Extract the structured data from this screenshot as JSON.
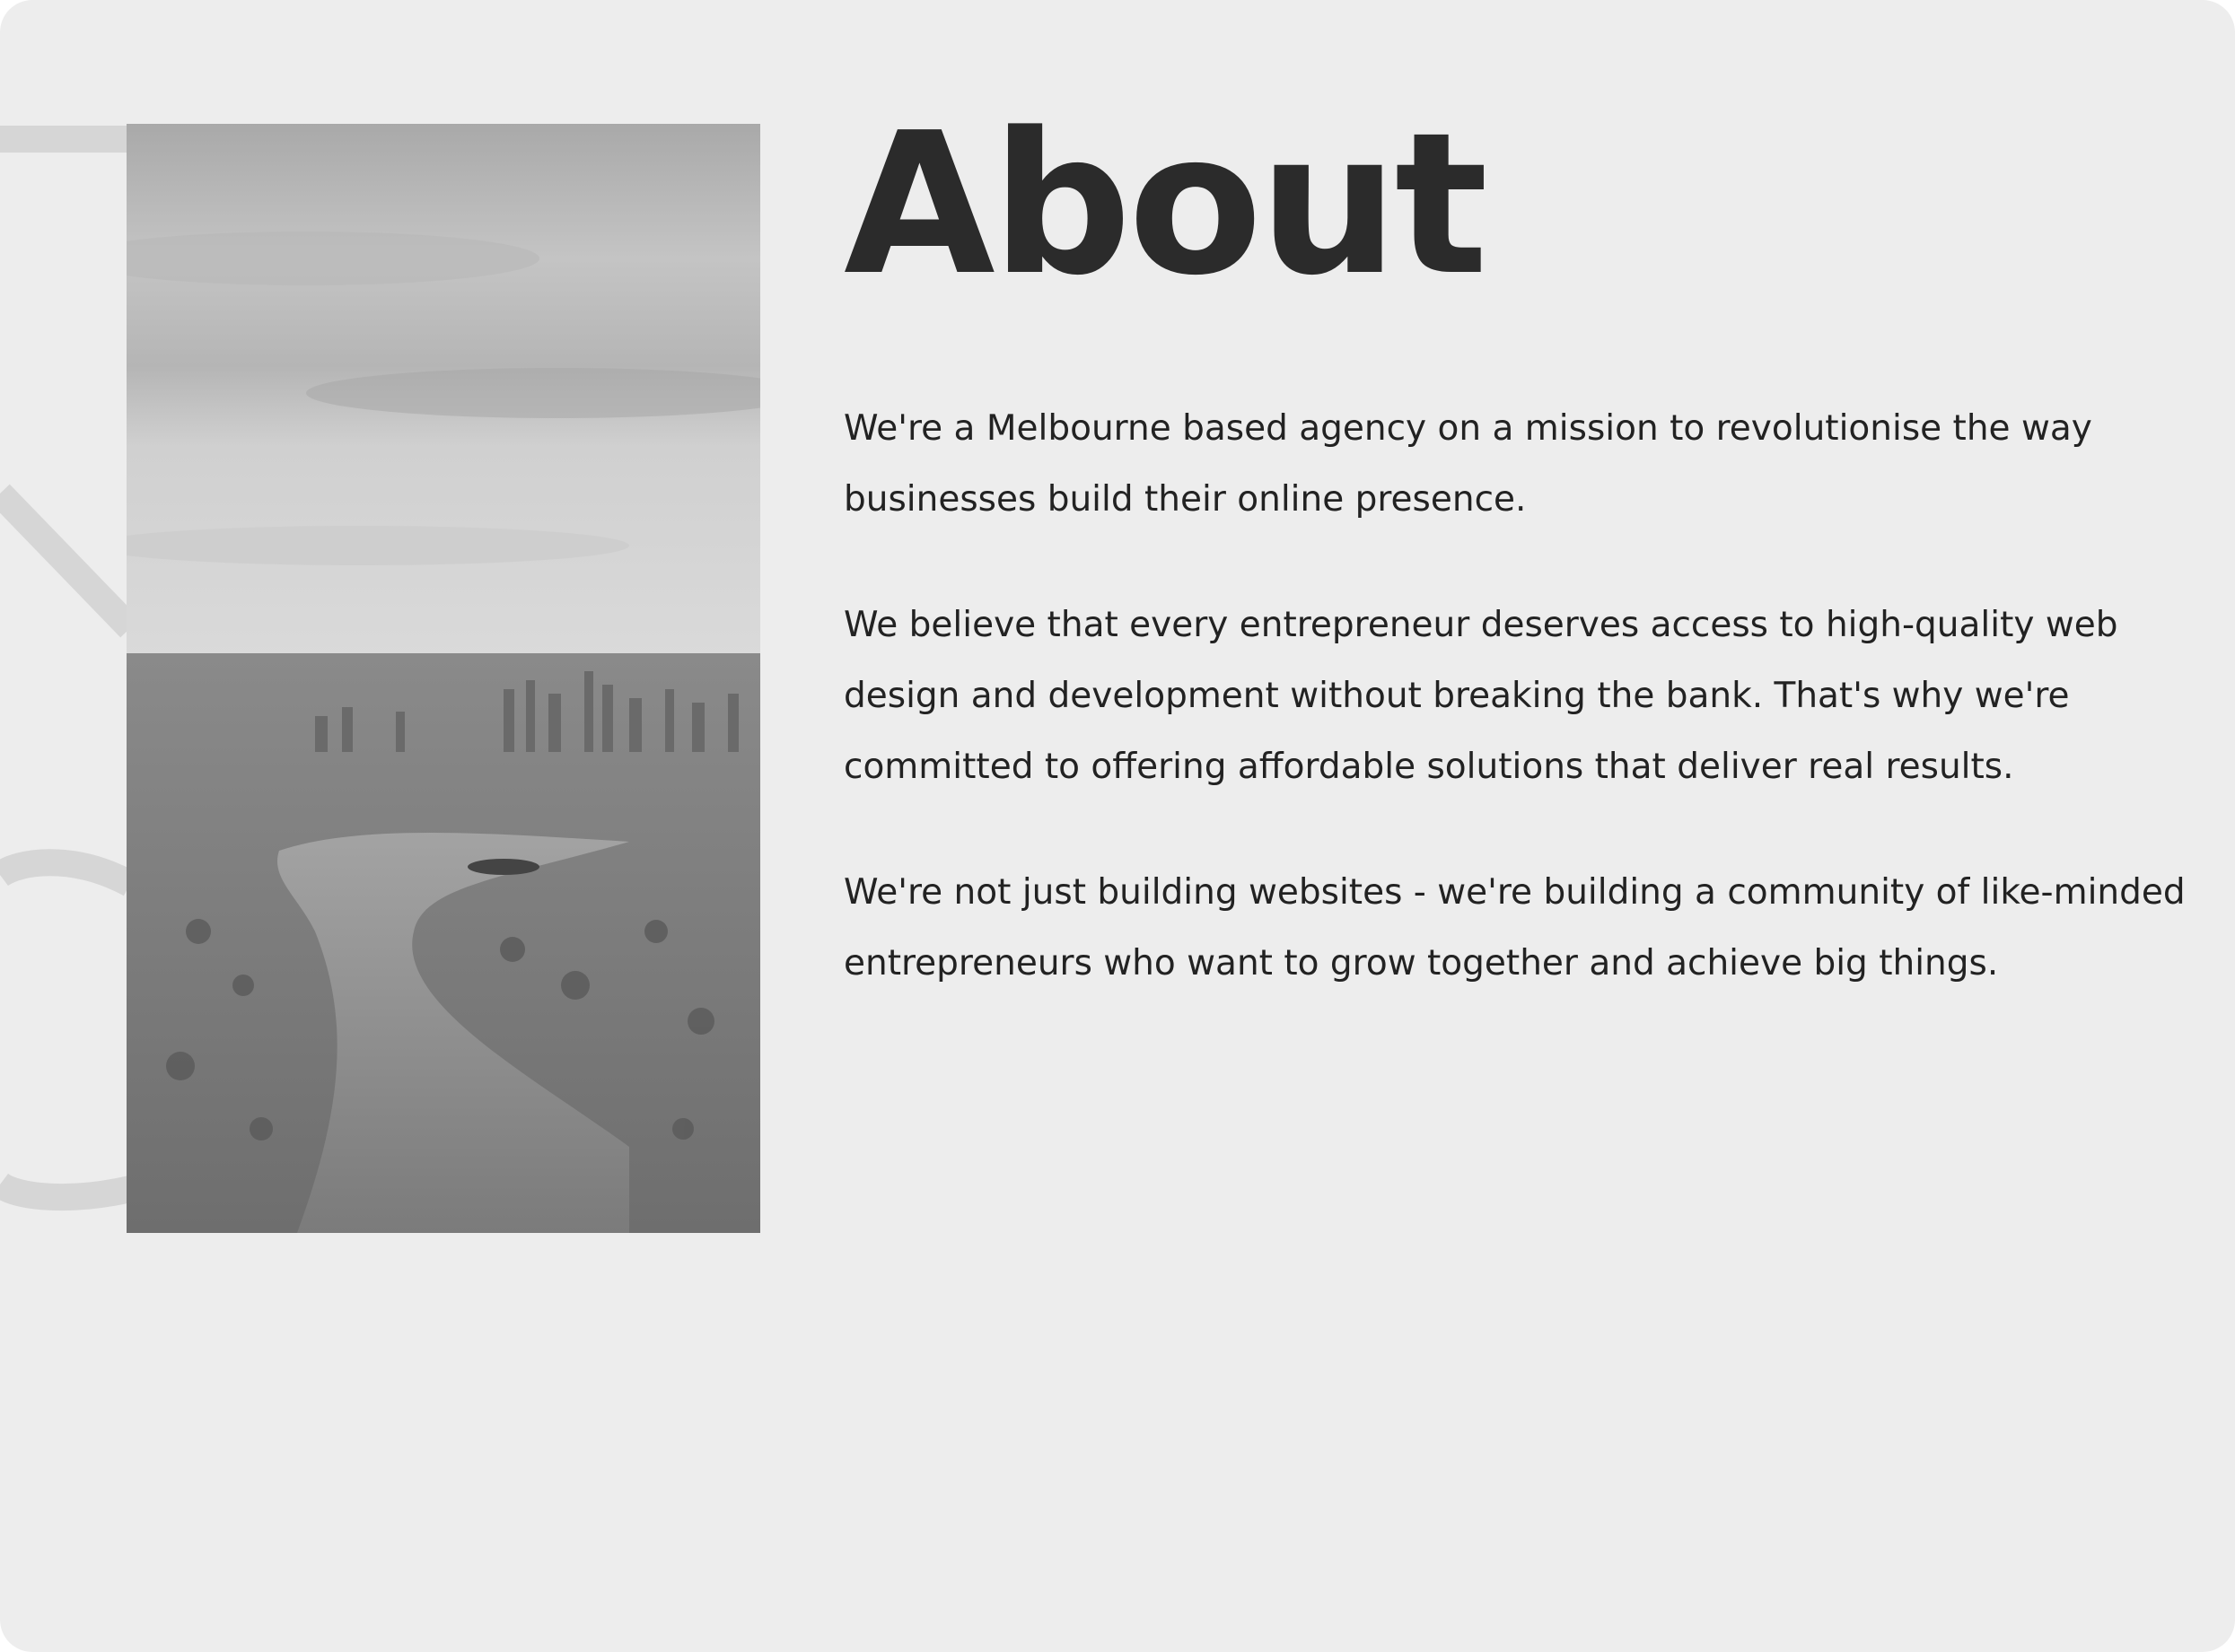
{
  "about": {
    "title": "About",
    "paragraphs": [
      "We're a Melbourne based agency on a mission to revolutionise the way businesses build their online presence.",
      "We believe that every entrepreneur deserves access to high-quality web design and development without breaking the bank. That's why we're committed to offering affordable solutions that deliver real results.",
      "We're not just building websites - we're building a community of like-minded entrepreneurs who want to grow together and achieve big things."
    ]
  },
  "colors": {
    "background": "#ededed",
    "heading": "#2b2b2b",
    "body_text": "#222222",
    "decorative_letter": "#d6d6d6"
  }
}
